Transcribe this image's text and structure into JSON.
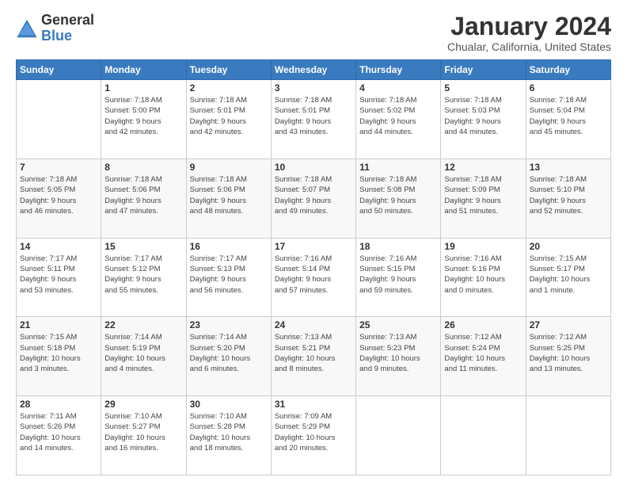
{
  "logo": {
    "general": "General",
    "blue": "Blue"
  },
  "header": {
    "month_year": "January 2024",
    "location": "Chualar, California, United States"
  },
  "days_of_week": [
    "Sunday",
    "Monday",
    "Tuesday",
    "Wednesday",
    "Thursday",
    "Friday",
    "Saturday"
  ],
  "weeks": [
    [
      {
        "day": "",
        "info": ""
      },
      {
        "day": "1",
        "info": "Sunrise: 7:18 AM\nSunset: 5:00 PM\nDaylight: 9 hours\nand 42 minutes."
      },
      {
        "day": "2",
        "info": "Sunrise: 7:18 AM\nSunset: 5:01 PM\nDaylight: 9 hours\nand 42 minutes."
      },
      {
        "day": "3",
        "info": "Sunrise: 7:18 AM\nSunset: 5:01 PM\nDaylight: 9 hours\nand 43 minutes."
      },
      {
        "day": "4",
        "info": "Sunrise: 7:18 AM\nSunset: 5:02 PM\nDaylight: 9 hours\nand 44 minutes."
      },
      {
        "day": "5",
        "info": "Sunrise: 7:18 AM\nSunset: 5:03 PM\nDaylight: 9 hours\nand 44 minutes."
      },
      {
        "day": "6",
        "info": "Sunrise: 7:18 AM\nSunset: 5:04 PM\nDaylight: 9 hours\nand 45 minutes."
      }
    ],
    [
      {
        "day": "7",
        "info": "Sunrise: 7:18 AM\nSunset: 5:05 PM\nDaylight: 9 hours\nand 46 minutes."
      },
      {
        "day": "8",
        "info": "Sunrise: 7:18 AM\nSunset: 5:06 PM\nDaylight: 9 hours\nand 47 minutes."
      },
      {
        "day": "9",
        "info": "Sunrise: 7:18 AM\nSunset: 5:06 PM\nDaylight: 9 hours\nand 48 minutes."
      },
      {
        "day": "10",
        "info": "Sunrise: 7:18 AM\nSunset: 5:07 PM\nDaylight: 9 hours\nand 49 minutes."
      },
      {
        "day": "11",
        "info": "Sunrise: 7:18 AM\nSunset: 5:08 PM\nDaylight: 9 hours\nand 50 minutes."
      },
      {
        "day": "12",
        "info": "Sunrise: 7:18 AM\nSunset: 5:09 PM\nDaylight: 9 hours\nand 51 minutes."
      },
      {
        "day": "13",
        "info": "Sunrise: 7:18 AM\nSunset: 5:10 PM\nDaylight: 9 hours\nand 52 minutes."
      }
    ],
    [
      {
        "day": "14",
        "info": "Sunrise: 7:17 AM\nSunset: 5:11 PM\nDaylight: 9 hours\nand 53 minutes."
      },
      {
        "day": "15",
        "info": "Sunrise: 7:17 AM\nSunset: 5:12 PM\nDaylight: 9 hours\nand 55 minutes."
      },
      {
        "day": "16",
        "info": "Sunrise: 7:17 AM\nSunset: 5:13 PM\nDaylight: 9 hours\nand 56 minutes."
      },
      {
        "day": "17",
        "info": "Sunrise: 7:16 AM\nSunset: 5:14 PM\nDaylight: 9 hours\nand 57 minutes."
      },
      {
        "day": "18",
        "info": "Sunrise: 7:16 AM\nSunset: 5:15 PM\nDaylight: 9 hours\nand 59 minutes."
      },
      {
        "day": "19",
        "info": "Sunrise: 7:16 AM\nSunset: 5:16 PM\nDaylight: 10 hours\nand 0 minutes."
      },
      {
        "day": "20",
        "info": "Sunrise: 7:15 AM\nSunset: 5:17 PM\nDaylight: 10 hours\nand 1 minute."
      }
    ],
    [
      {
        "day": "21",
        "info": "Sunrise: 7:15 AM\nSunset: 5:18 PM\nDaylight: 10 hours\nand 3 minutes."
      },
      {
        "day": "22",
        "info": "Sunrise: 7:14 AM\nSunset: 5:19 PM\nDaylight: 10 hours\nand 4 minutes."
      },
      {
        "day": "23",
        "info": "Sunrise: 7:14 AM\nSunset: 5:20 PM\nDaylight: 10 hours\nand 6 minutes."
      },
      {
        "day": "24",
        "info": "Sunrise: 7:13 AM\nSunset: 5:21 PM\nDaylight: 10 hours\nand 8 minutes."
      },
      {
        "day": "25",
        "info": "Sunrise: 7:13 AM\nSunset: 5:23 PM\nDaylight: 10 hours\nand 9 minutes."
      },
      {
        "day": "26",
        "info": "Sunrise: 7:12 AM\nSunset: 5:24 PM\nDaylight: 10 hours\nand 11 minutes."
      },
      {
        "day": "27",
        "info": "Sunrise: 7:12 AM\nSunset: 5:25 PM\nDaylight: 10 hours\nand 13 minutes."
      }
    ],
    [
      {
        "day": "28",
        "info": "Sunrise: 7:11 AM\nSunset: 5:26 PM\nDaylight: 10 hours\nand 14 minutes."
      },
      {
        "day": "29",
        "info": "Sunrise: 7:10 AM\nSunset: 5:27 PM\nDaylight: 10 hours\nand 16 minutes."
      },
      {
        "day": "30",
        "info": "Sunrise: 7:10 AM\nSunset: 5:28 PM\nDaylight: 10 hours\nand 18 minutes."
      },
      {
        "day": "31",
        "info": "Sunrise: 7:09 AM\nSunset: 5:29 PM\nDaylight: 10 hours\nand 20 minutes."
      },
      {
        "day": "",
        "info": ""
      },
      {
        "day": "",
        "info": ""
      },
      {
        "day": "",
        "info": ""
      }
    ]
  ]
}
